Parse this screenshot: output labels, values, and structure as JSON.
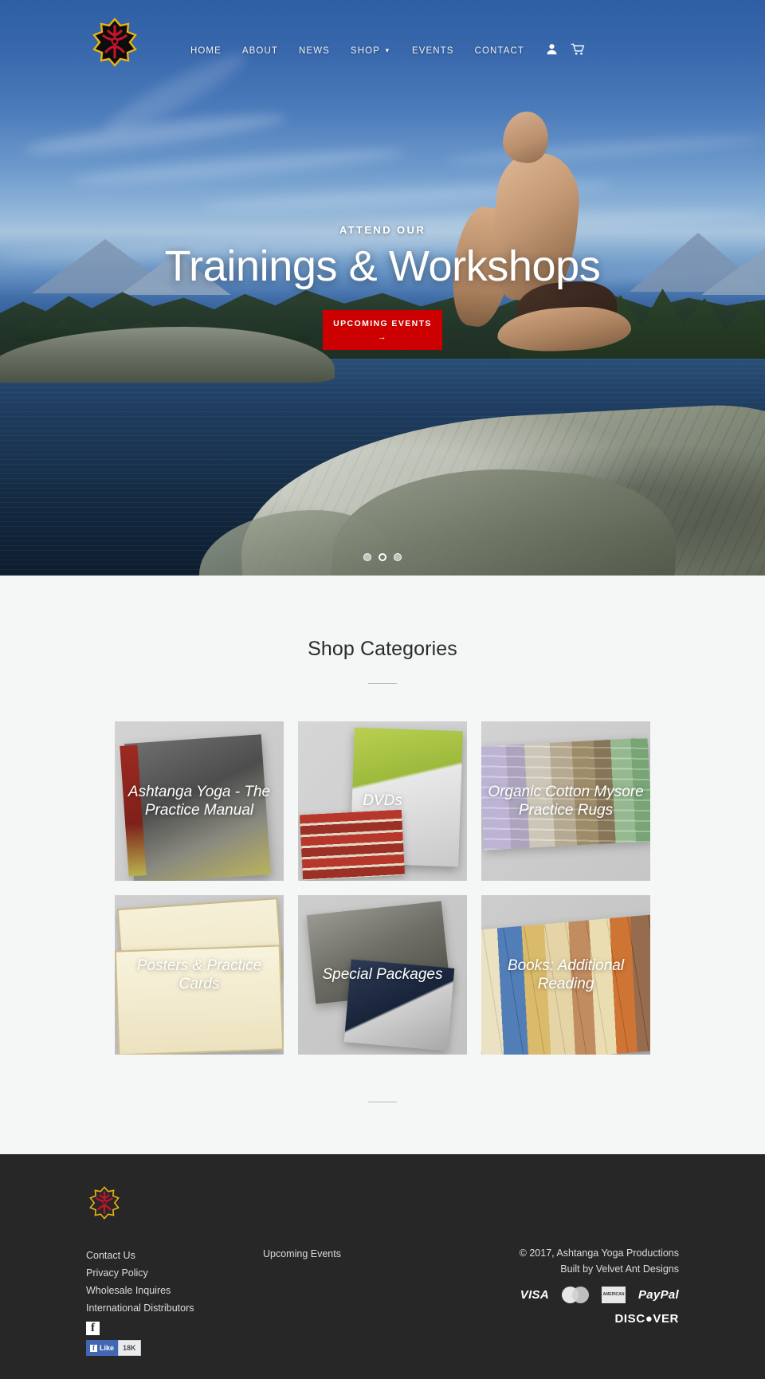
{
  "header": {
    "logo_alt": "Ashtanga Yoga Productions logo",
    "nav": [
      {
        "label": "HOME",
        "has_caret": false
      },
      {
        "label": "ABOUT",
        "has_caret": false
      },
      {
        "label": "NEWS",
        "has_caret": false
      },
      {
        "label": "SHOP",
        "has_caret": true
      },
      {
        "label": "EVENTS",
        "has_caret": false
      },
      {
        "label": "CONTACT",
        "has_caret": false
      }
    ],
    "account_icon": "user-icon",
    "cart_icon": "cart-icon"
  },
  "hero": {
    "kicker": "ATTEND OUR",
    "title": "Trainings & Workshops",
    "cta_label": "UPCOMING EVENTS",
    "cta_arrow": "→",
    "accent_color": "#cc0000",
    "slides": [
      {
        "active": false
      },
      {
        "active": true
      },
      {
        "active": false
      }
    ]
  },
  "categories": {
    "title": "Shop Categories",
    "tiles": [
      {
        "label": "Ashtanga Yoga - The Practice Manual",
        "art": "art-manual"
      },
      {
        "label": "DVDs",
        "art": "art-dvd"
      },
      {
        "label": "Organic Cotton Mysore Practice Rugs",
        "art": "art-rugs"
      },
      {
        "label": "Posters & Practice Cards",
        "art": "art-cards"
      },
      {
        "label": "Special Packages",
        "art": "art-pack"
      },
      {
        "label": "Books: Additional Reading",
        "art": "art-books"
      }
    ]
  },
  "footer": {
    "logo_alt": "Ashtanga Yoga Productions logo",
    "links_primary": [
      "Contact Us",
      "Privacy Policy",
      "Wholesale Inquires",
      "International Distributors"
    ],
    "facebook_icon": "facebook-icon",
    "facebook_like": {
      "label": "Like",
      "count": "18K"
    },
    "links_secondary": [
      "Upcoming Events"
    ],
    "copyright": "© 2017, Ashtanga Yoga Productions",
    "built_by": "Built by Velvet Ant Designs",
    "payments": [
      "VISA",
      "MasterCard",
      "American Express",
      "PayPal",
      "DISCOVER"
    ],
    "payment_visa": "VISA",
    "payment_amex_line1": "AMERICAN",
    "payment_amex_line2": "EXPRESS",
    "payment_paypal": "PayPal",
    "payment_discover": "DISC●VER",
    "background_color": "#272727"
  }
}
